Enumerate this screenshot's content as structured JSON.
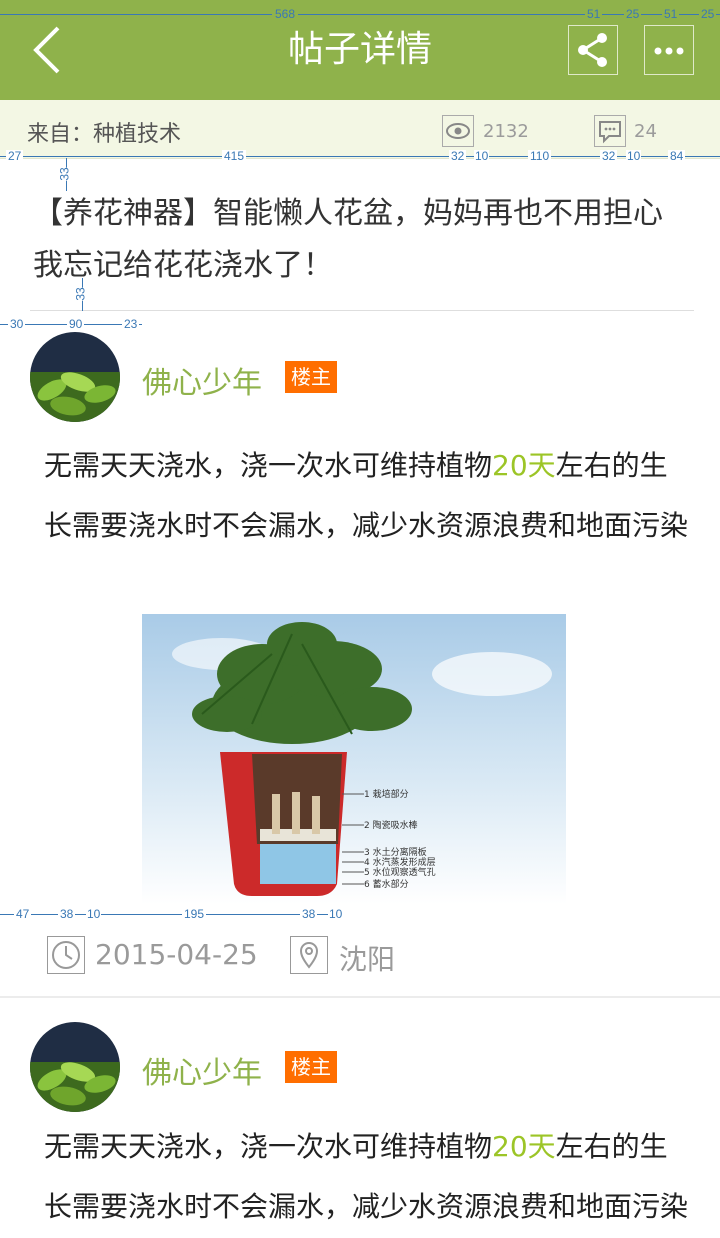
{
  "header": {
    "title": "帖子详情",
    "back_icon": "chevron-left-icon",
    "share_icon": "share-icon",
    "more_icon": "more-dots-icon",
    "bg_color": "#8fb24b"
  },
  "source_bar": {
    "label": "来自：种植技术",
    "views": "2132",
    "comments": "24"
  },
  "post": {
    "title": "【养花神器】智能懒人花盆，妈妈再也不用担心我忘记给花花浇水了！"
  },
  "floors": [
    {
      "username": "佛心少年",
      "badge": "楼主",
      "content_before": "无需天天浇水，浇一次水可维持植物",
      "content_highlight": "20天",
      "content_after": "左右的生长需要浇水时不会漏水，减少水资源浪费和地面污染",
      "image_labels": [
        "1 栽培部分",
        "2 陶瓷吸水棒",
        "3 水土分离隔板",
        "4 水汽蒸发形成层",
        "5 水位观察透气孔",
        "6 蓄水部分"
      ],
      "date": "2015-04-25",
      "location": "沈阳"
    },
    {
      "username": "佛心少年",
      "badge": "楼主",
      "content_before": "无需天天浇水，浇一次水可维持植物",
      "content_highlight": "20天",
      "content_after": "左右的生长需要浇水时不会漏水，减少水资源浪费和地面污染"
    }
  ],
  "annotations": {
    "top": [
      "568",
      "51",
      "25",
      "51",
      "25"
    ],
    "source_row": [
      "27",
      "415",
      "32",
      "10",
      "110",
      "32",
      "10",
      "84"
    ],
    "title_gap": "33",
    "title_gap2": "33",
    "avatar_row": [
      "30",
      "90",
      "23"
    ],
    "meta_row": [
      "47",
      "38",
      "10",
      "195",
      "38",
      "10"
    ]
  }
}
